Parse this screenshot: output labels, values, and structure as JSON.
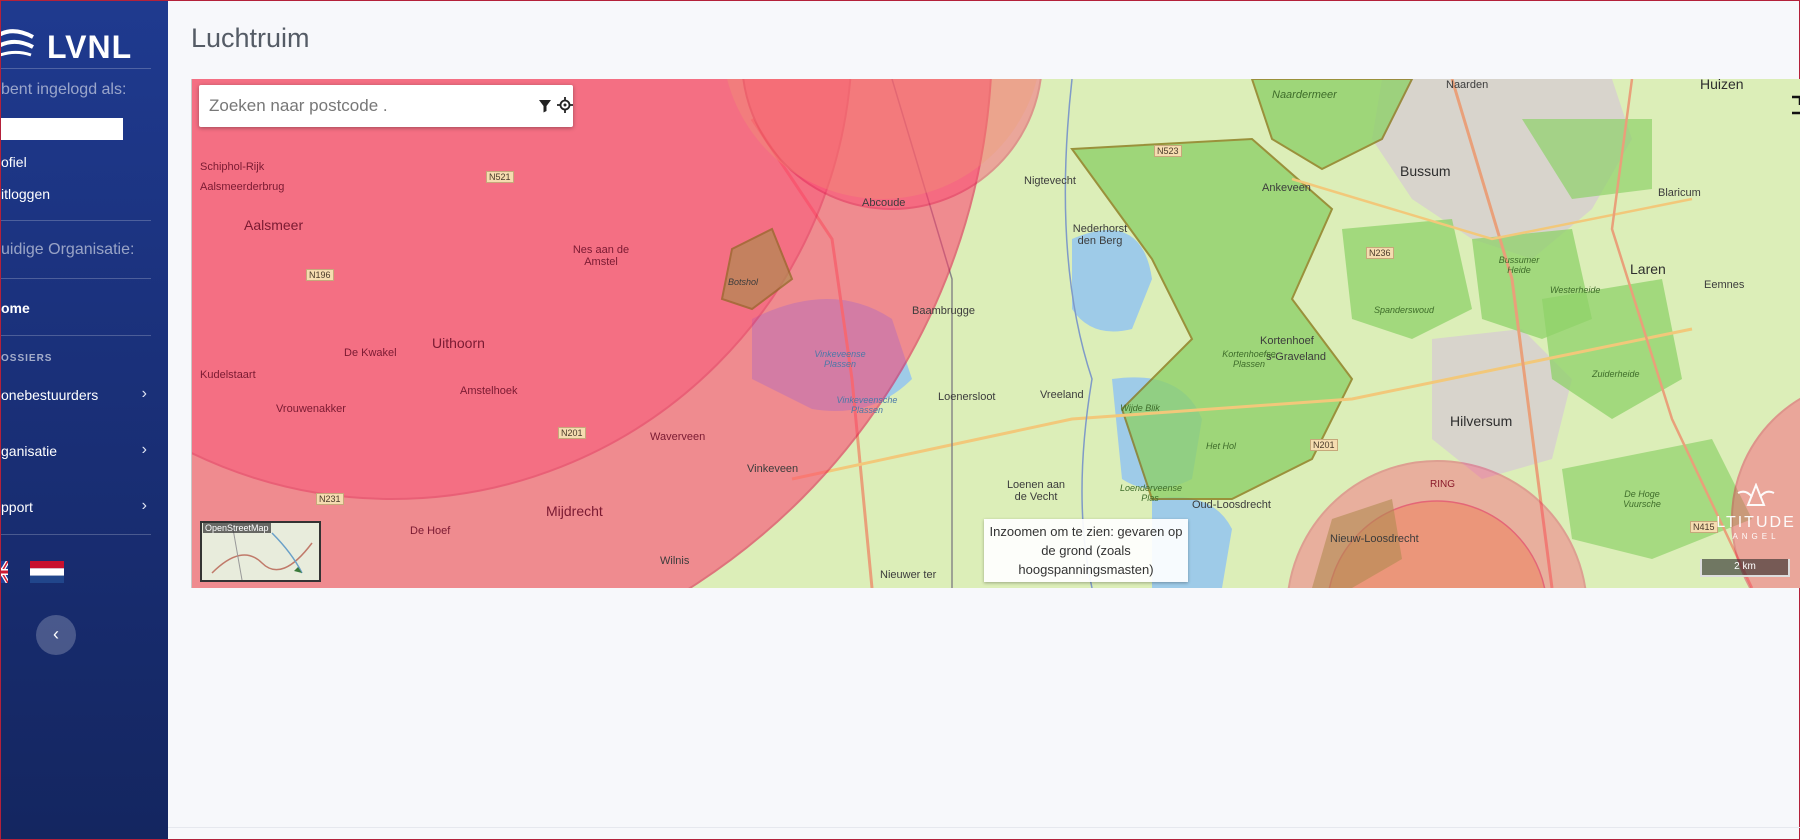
{
  "sidebar": {
    "logo_text": "LVNL",
    "logged_in_label": "bent ingelogd als:",
    "user_value": "",
    "profile_link": "ofiel",
    "logout_link": "itloggen",
    "org_label": "uidige Organisatie:",
    "home_link": "ome",
    "section_header": "OSSIERS",
    "items": [
      {
        "label": "onebestuurders"
      },
      {
        "label": "ganisatie"
      },
      {
        "label": "pport"
      }
    ],
    "chevron": "›",
    "collapse_icon": "‹",
    "flags": [
      "uk-flag-icon",
      "nl-flag-icon"
    ]
  },
  "page": {
    "title": "Luchtruim"
  },
  "map": {
    "search_placeholder": "Zoeken naar postcode .",
    "tooltip": "Inzoomen om te zien: gevaren op de grond (zoals hoogspanningsmasten)",
    "minimap_label": "OpenStreetMap",
    "scale_label": "2 km",
    "brand_name": "LTITUDE",
    "brand_sub": "ANGEL",
    "places": {
      "schiphol_rijk": "Schiphol-Rijk",
      "aalsmeerderbrug": "Aalsmeerderbrug",
      "aalsmeer": "Aalsmeer",
      "uithoorn": "Uithoorn",
      "de_kwakel": "De Kwakel",
      "kudelstaart": "Kudelstaart",
      "vrouwenakker": "Vrouwenakker",
      "amstelhoek": "Amstelhoek",
      "nes_aan_de_amstel": "Nes aan de Amstel",
      "mijdrecht": "Mijdrecht",
      "de_hoef": "De Hoef",
      "waverveen": "Waverveen",
      "vinkeveen": "Vinkeveen",
      "wilnis": "Wilnis",
      "abcoude": "Abcoude",
      "baambrugge": "Baambrugge",
      "loenersloot": "Loenersloot",
      "vreeland": "Vreeland",
      "loenen_aan_de_vecht": "Loenen aan de Vecht",
      "nieuwer_ter": "Nieuwer ter",
      "nigtevecht": "Nigtevecht",
      "nederhorst": "Nederhorst den Berg",
      "ankeveen": "Ankeveen",
      "kortenhoef": "Kortenhoef",
      "s_graveland": "'s-Graveland",
      "oud_loosdrecht": "Oud-Loosdrecht",
      "nieuw_loosdrecht": "Nieuw-Loosdrecht",
      "hilversum": "Hilversum",
      "bussum": "Bussum",
      "naarden": "Naarden",
      "huizen": "Huizen",
      "blaricum": "Blaricum",
      "laren": "Laren",
      "eemnes": "Eemnes",
      "botshol": "Botshol",
      "naardermeer": "Naardermeer",
      "ring": "RING"
    },
    "roads": {
      "n521": "N521",
      "n196": "N196",
      "n201a": "N201",
      "n231": "N231",
      "n523": "N523",
      "n236": "N236",
      "n201b": "N201",
      "n415": "N415"
    },
    "areas": {
      "bussumer_heide": "Bussumer Heide",
      "westerheide": "Westerheide",
      "spanderswoud": "Spanderswoud",
      "zuiderheide": "Zuiderheide",
      "kortenhoefse_plassen": "Kortenhoefse Plassen",
      "wijde_blik": "Wijde Blik",
      "het_hol": "Het Hol",
      "loenderveense_plas": "Loenderveense Plas",
      "vinkeveense_plassen_1": "Vinkeveense Plassen",
      "vinkeveense_plassen_2": "Vinkeveensche Plassen",
      "de_hoge_vuursche": "De Hoge Vuursche"
    },
    "colors": {
      "restricted_red": "#ff3c6e",
      "restricted_border": "#e0104a",
      "orange_zone": "#f08a5a",
      "nature_green": "#7ccb5a",
      "water_blue": "#9ecbe8",
      "land": "#dceeb8"
    }
  }
}
